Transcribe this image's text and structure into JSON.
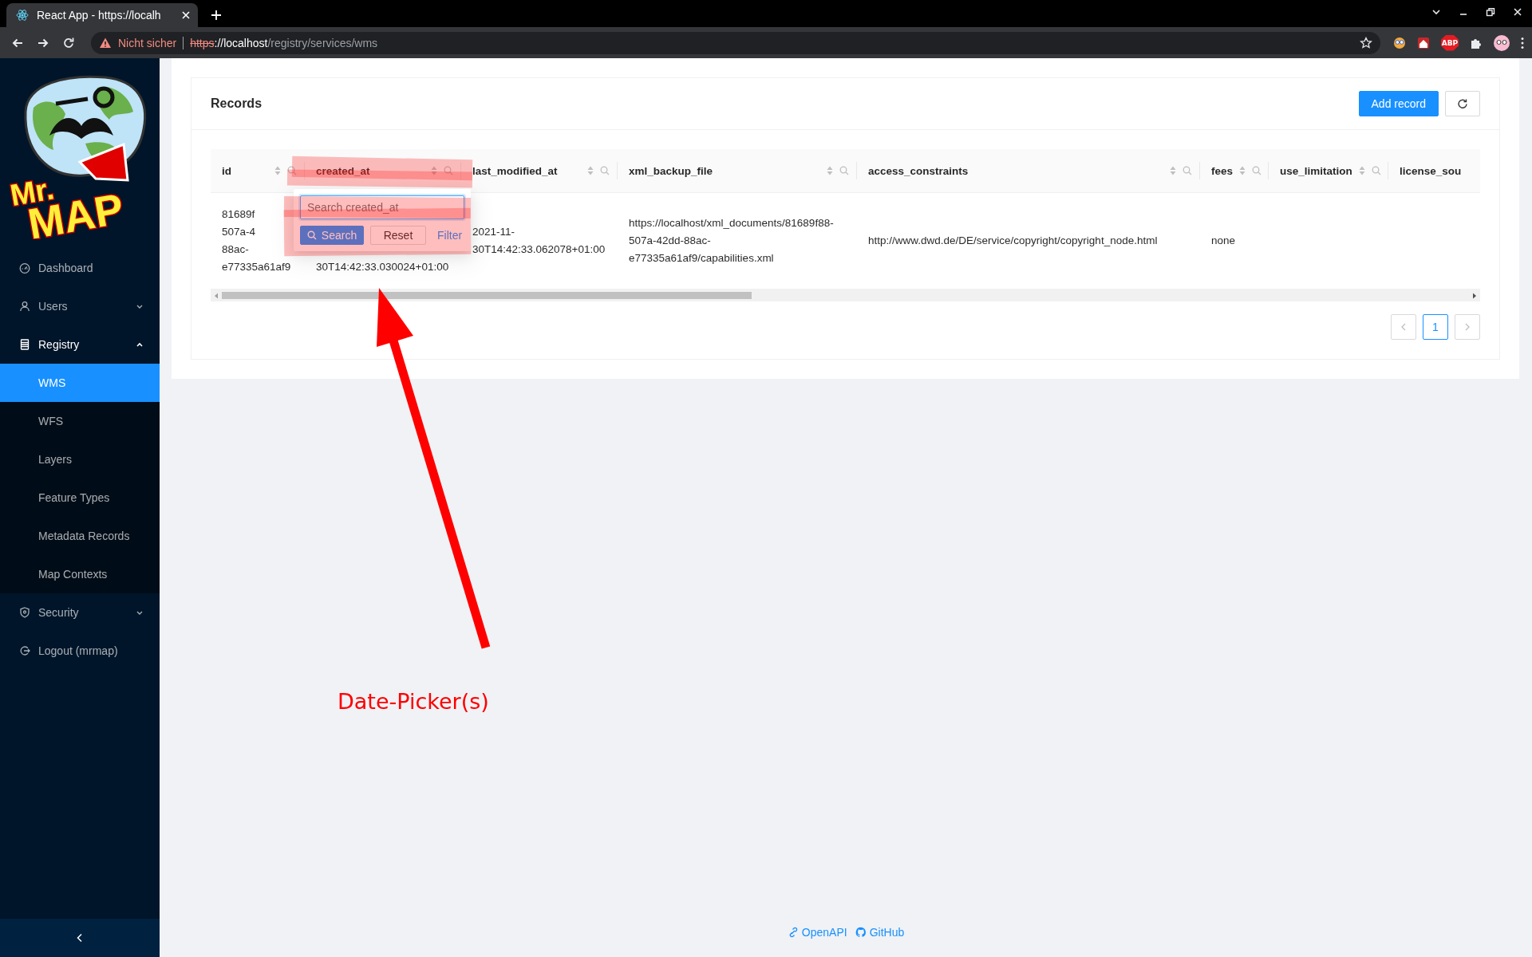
{
  "browser": {
    "tab_title": "React App - https://localh",
    "security_label": "Nicht sicher",
    "url": {
      "scheme": "https",
      "host": "://localhost",
      "path": "/registry/services/wms"
    },
    "extension_badge": "ABP"
  },
  "sidebar": {
    "logo": {
      "line_1": "Mr.",
      "line_2": "MAP"
    },
    "items": [
      {
        "kind": "link",
        "label": "Dashboard"
      },
      {
        "kind": "submenu",
        "label": "Users",
        "expanded": false
      },
      {
        "kind": "submenu",
        "label": "Registry",
        "expanded": true,
        "children": [
          {
            "label": "WMS",
            "selected": true
          },
          {
            "label": "WFS",
            "selected": false
          },
          {
            "label": "Layers",
            "selected": false
          },
          {
            "label": "Feature Types",
            "selected": false
          },
          {
            "label": "Metadata Records",
            "selected": false
          },
          {
            "label": "Map Contexts",
            "selected": false
          }
        ]
      },
      {
        "kind": "submenu",
        "label": "Security",
        "expanded": false
      },
      {
        "kind": "link",
        "label": "Logout (mrmap)"
      }
    ]
  },
  "card": {
    "title": "Records",
    "add_button": "Add record"
  },
  "table": {
    "columns": [
      {
        "label": "id",
        "sortable": true
      },
      {
        "label": "created_at",
        "sortable": true
      },
      {
        "label": "last_modified_at",
        "sortable": true
      },
      {
        "label": "xml_backup_file",
        "sortable": true
      },
      {
        "label": "access_constraints",
        "sortable": true
      },
      {
        "label": "fees",
        "sortable": true
      },
      {
        "label": "use_limitation",
        "sortable": true
      },
      {
        "label": "license_sou",
        "sortable": false
      }
    ],
    "rows": [
      {
        "cells": [
          "81689f\n507a-4\n88ac-\ne77335a61af9",
          "30T14:42:33.030024+01:00",
          "2021-11-\n30T14:42:33.062078+01:00",
          "https://localhost/xml_documents/81689f88-\n507a-42dd-88ac-\ne77335a61af9/capabilities.xml",
          "http://www.dwd.de/DE/service/copyright/copyright_node.html",
          "none"
        ]
      }
    ],
    "filter_dropdown": {
      "placeholder": "Search created_at",
      "search_button": "Search",
      "reset_button": "Reset",
      "filter_link": "Filter"
    }
  },
  "pagination": {
    "pages": [
      {
        "label": "1",
        "selected": true
      }
    ]
  },
  "annotation": {
    "label": "Date-Picker(s)"
  },
  "footer": {
    "links": [
      "OpenAPI",
      "GitHub"
    ]
  }
}
